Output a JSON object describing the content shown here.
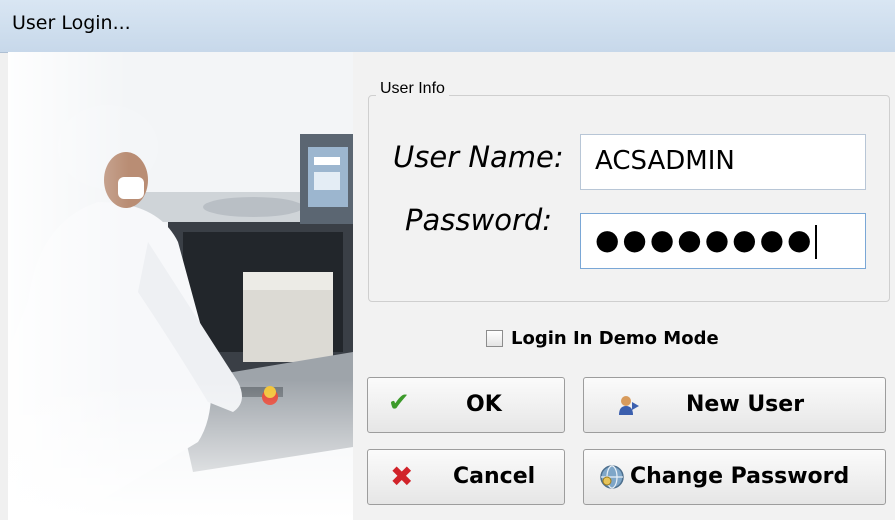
{
  "window": {
    "title": "User Login..."
  },
  "user_info": {
    "group_label": "User Info",
    "username_label": "User Name:",
    "username_value": "ACSADMIN",
    "password_label": "Password:",
    "password_value": "●●●●●●●●"
  },
  "demo_mode": {
    "label": "Login In Demo Mode",
    "checked": false
  },
  "buttons": {
    "ok": "OK",
    "new_user": "New User",
    "cancel": "Cancel",
    "change_password": "Change Password"
  },
  "icons": {
    "ok": "check-icon",
    "new_user": "user-icon",
    "cancel": "x-icon",
    "change_password": "globe-key-icon"
  },
  "colors": {
    "ok_check": "#3c9a2a",
    "cancel_x": "#d1232a",
    "titlebar": "#cfdeee"
  }
}
